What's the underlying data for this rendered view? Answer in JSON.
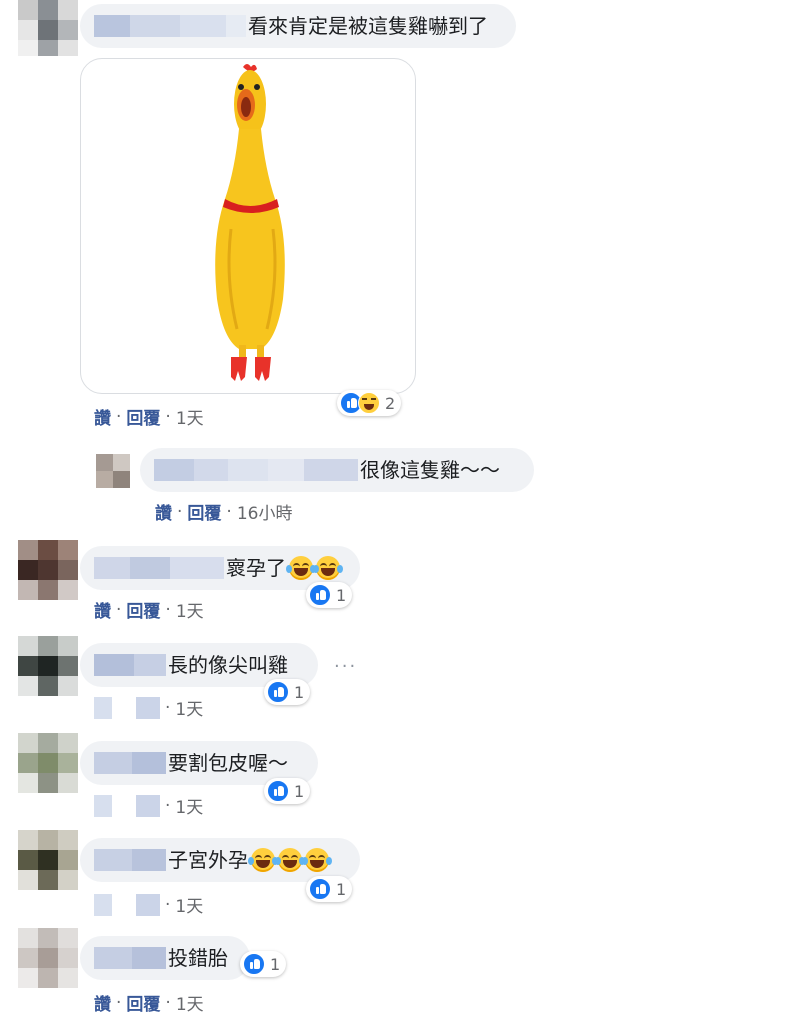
{
  "comments": [
    {
      "text": "看來肯定是被這隻雞嚇到了",
      "like_label": "讚",
      "reply_label": "回覆",
      "time": "1天",
      "reaction_count": "2"
    },
    {
      "text": "很像這隻雞～～",
      "like_label": "讚",
      "reply_label": "回覆",
      "time": "16小時"
    },
    {
      "text": "褱孕了",
      "like_label": "讚",
      "reply_label": "回覆",
      "time": "1天",
      "reaction_count": "1"
    },
    {
      "text": "長的像尖叫雞",
      "time": "1天",
      "reaction_count": "1"
    },
    {
      "text": "要割包皮喔～",
      "time": "1天",
      "reaction_count": "1"
    },
    {
      "text": "子宮外孕",
      "time": "1天",
      "reaction_count": "1"
    },
    {
      "text": "投錯胎",
      "like_label": "讚",
      "reply_label": "回覆",
      "time": "1天",
      "reaction_count": "1"
    }
  ],
  "separator": "·",
  "more_dots": "···",
  "colors": {
    "action": "#385898",
    "bubble": "#f0f2f5",
    "like": "#1877f2",
    "meta": "#65676b"
  },
  "icons": [
    "like-icon",
    "haha-icon",
    "laughing-crying-emoji-icon",
    "more-options-icon",
    "rubber-chicken-image"
  ]
}
